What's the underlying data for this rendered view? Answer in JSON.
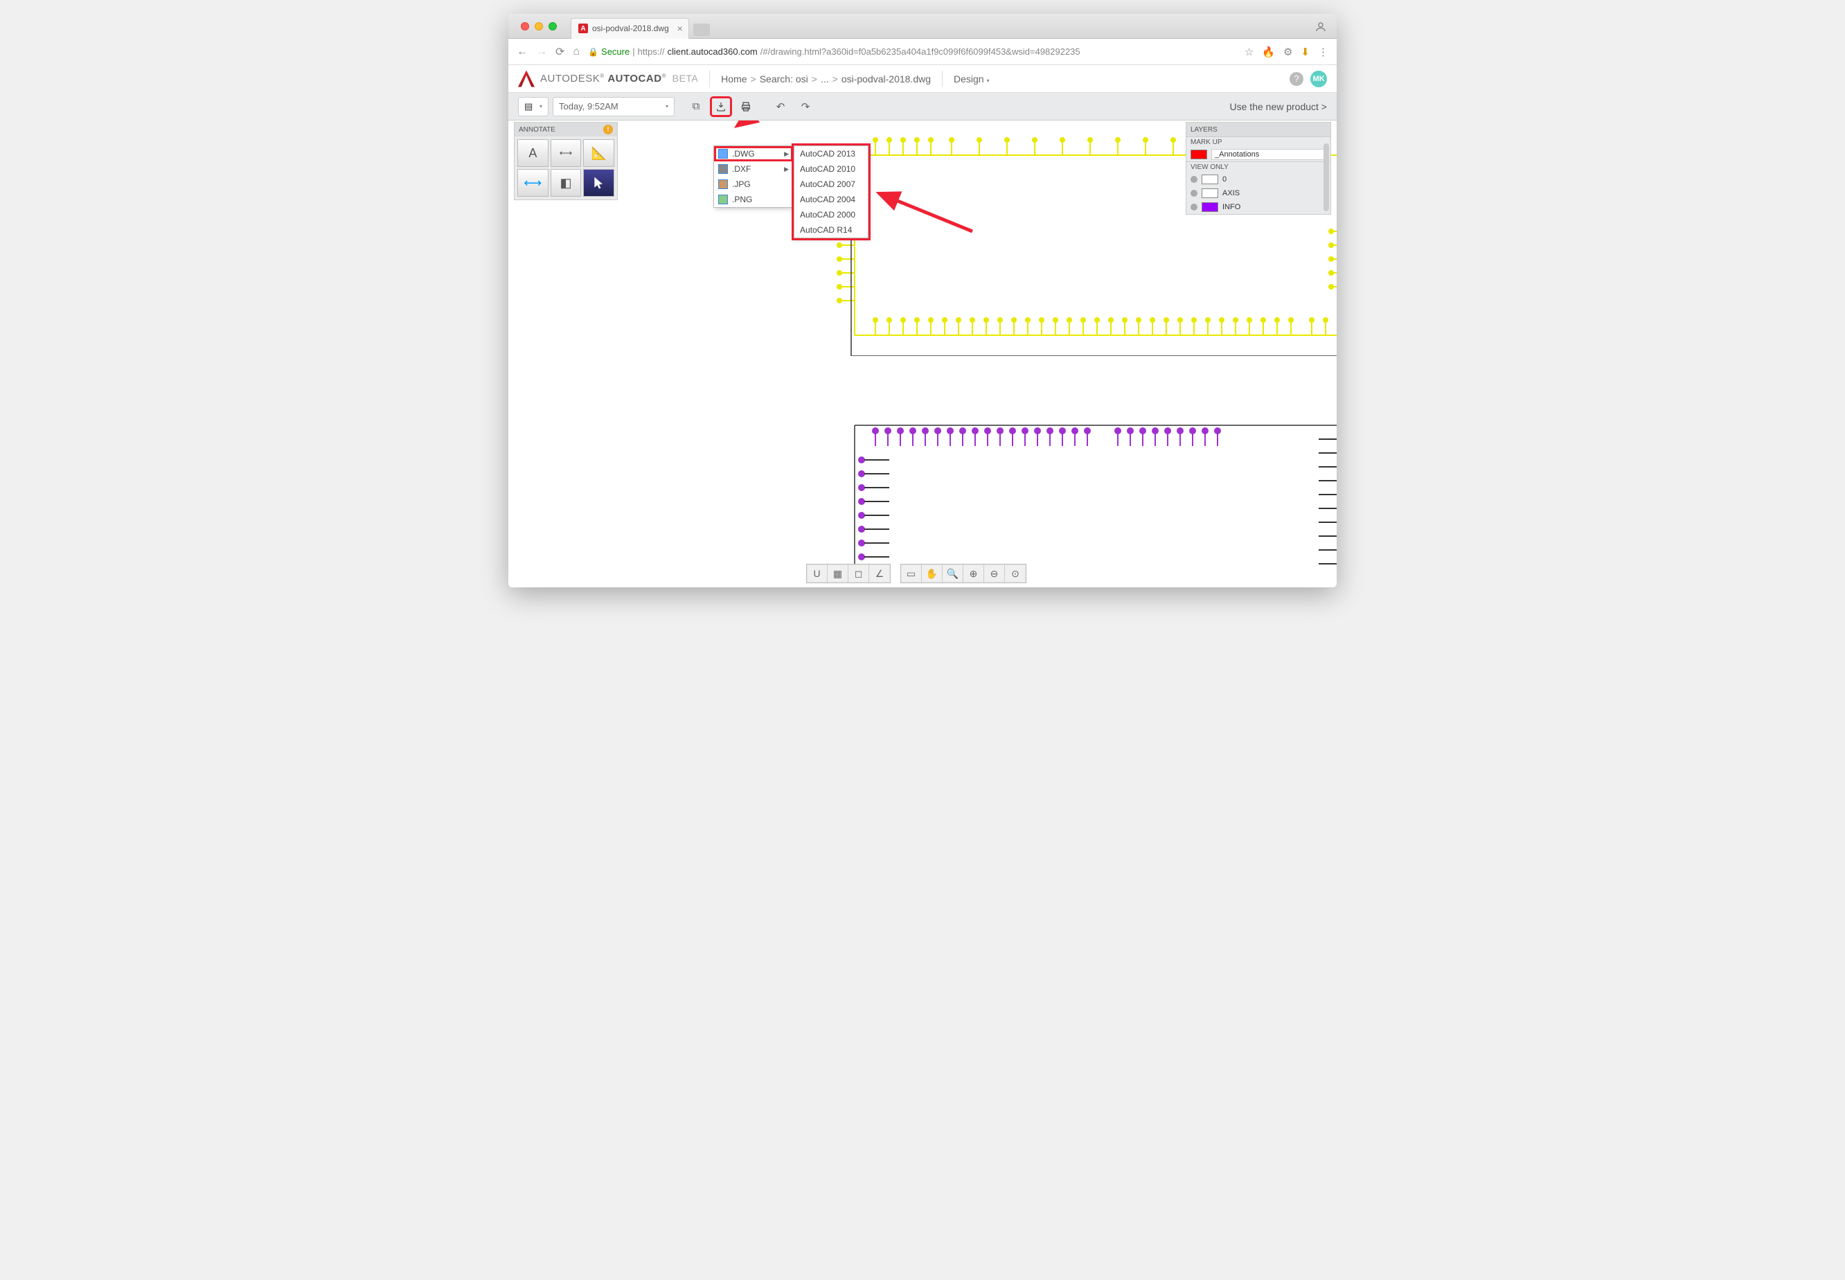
{
  "tab": {
    "title": "osi-podval-2018.dwg"
  },
  "url": {
    "secure": "Secure",
    "host": "client.autocad360.com",
    "path": "/#/drawing.html?a360id=f0a5b6235a404a1f9c099f6f6099f453&wsid=498292235",
    "prefix": "https://"
  },
  "brand": {
    "autodesk": "AUTODESK",
    "autocad": "AUTOCAD",
    "beta": "BETA",
    "reg": "®"
  },
  "breadcrumb": {
    "home": "Home",
    "search": "Search: osi",
    "dots": "...",
    "file": "osi-podval-2018.dwg",
    "mode": "Design"
  },
  "avatar": "MK",
  "toolbar": {
    "date": "Today, 9:52AM",
    "new_product": "Use the new product >"
  },
  "annotate": {
    "title": "ANNOTATE"
  },
  "export_menu": [
    {
      "label": ".DWG",
      "submenu": true,
      "hl": true
    },
    {
      "label": ".DXF",
      "submenu": true
    },
    {
      "label": ".JPG"
    },
    {
      "label": ".PNG"
    }
  ],
  "dwg_submenu": [
    "AutoCAD 2013",
    "AutoCAD 2010",
    "AutoCAD 2007",
    "AutoCAD 2004",
    "AutoCAD 2000",
    "AutoCAD R14"
  ],
  "layers": {
    "title": "LAYERS",
    "markup": "MARK UP",
    "markup_item": "_Annotations",
    "viewonly": "VIEW ONLY",
    "items": [
      {
        "name": "0",
        "color": "wh"
      },
      {
        "name": "AXIS",
        "color": "wh"
      },
      {
        "name": "INFO",
        "color": "pu"
      }
    ]
  }
}
